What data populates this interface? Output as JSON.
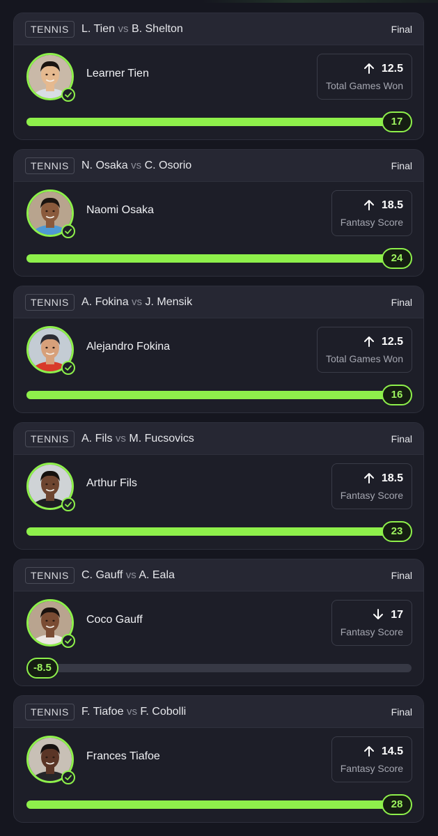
{
  "cards": [
    {
      "sport": "TENNIS",
      "player1": "L. Tien",
      "vs": "vs",
      "player2": "B. Shelton",
      "status": "Final",
      "player_name": "Learner Tien",
      "direction": "up",
      "line": "12.5",
      "stat_label": "Total Games Won",
      "result": "17",
      "progress": 1.0,
      "skin": "#e5b98f",
      "hair": "#1a1410",
      "shirt": "#d8dde4",
      "bg": "#c9b9a8"
    },
    {
      "sport": "TENNIS",
      "player1": "N. Osaka",
      "vs": "vs",
      "player2": "C. Osorio",
      "status": "Final",
      "player_name": "Naomi Osaka",
      "direction": "up",
      "line": "18.5",
      "stat_label": "Fantasy Score",
      "result": "24",
      "progress": 1.0,
      "skin": "#8a5a3c",
      "hair": "#1b1410",
      "shirt": "#4f9ad4",
      "bg": "#b8a48e"
    },
    {
      "sport": "TENNIS",
      "player1": "A. Fokina",
      "vs": "vs",
      "player2": "J. Mensik",
      "status": "Final",
      "player_name": "Alejandro Fokina",
      "direction": "up",
      "line": "12.5",
      "stat_label": "Total Games Won",
      "result": "16",
      "progress": 1.0,
      "skin": "#d7a07a",
      "hair": "#2c2c34",
      "shirt": "#d83a2a",
      "bg": "#c4ccd4"
    },
    {
      "sport": "TENNIS",
      "player1": "A. Fils",
      "vs": "vs",
      "player2": "M. Fucsovics",
      "status": "Final",
      "player_name": "Arthur Fils",
      "direction": "up",
      "line": "18.5",
      "stat_label": "Fantasy Score",
      "result": "23",
      "progress": 1.0,
      "skin": "#6e4530",
      "hair": "#15110e",
      "shirt": "#1d1d22",
      "bg": "#cfd3d6"
    },
    {
      "sport": "TENNIS",
      "player1": "C. Gauff",
      "vs": "vs",
      "player2": "A. Eala",
      "status": "Final",
      "player_name": "Coco Gauff",
      "direction": "down",
      "line": "17",
      "stat_label": "Fantasy Score",
      "result": "-8.5",
      "progress": 0.0,
      "skin": "#7a4c33",
      "hair": "#1a120e",
      "shirt": "#ece7e2",
      "bg": "#b9a48f"
    },
    {
      "sport": "TENNIS",
      "player1": "F. Tiafoe",
      "vs": "vs",
      "player2": "F. Cobolli",
      "status": "Final",
      "player_name": "Frances Tiafoe",
      "direction": "up",
      "line": "14.5",
      "stat_label": "Fantasy Score",
      "result": "28",
      "progress": 1.0,
      "skin": "#5a3526",
      "hair": "#161110",
      "shirt": "#262629",
      "bg": "#c8c0b6"
    }
  ],
  "colors": {
    "accent": "#8ef04b",
    "card_bg": "#1d1e28",
    "header_bg": "#262733",
    "page_bg": "#15161f"
  }
}
